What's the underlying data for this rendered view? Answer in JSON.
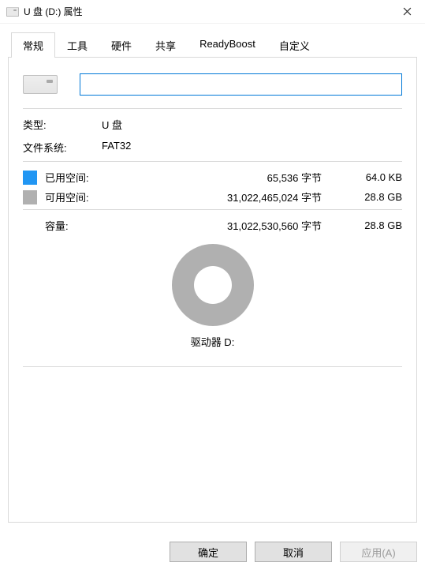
{
  "titlebar": {
    "title": "U 盘 (D:) 属性"
  },
  "tabs": [
    {
      "label": "常规",
      "active": true
    },
    {
      "label": "工具",
      "active": false
    },
    {
      "label": "硬件",
      "active": false
    },
    {
      "label": "共享",
      "active": false
    },
    {
      "label": "ReadyBoost",
      "active": false
    },
    {
      "label": "自定义",
      "active": false
    }
  ],
  "general": {
    "name_value": "",
    "type_label": "类型:",
    "type_value": "U 盘",
    "fs_label": "文件系统:",
    "fs_value": "FAT32",
    "used_label": "已用空间:",
    "used_bytes": "65,536 字节",
    "used_human": "64.0 KB",
    "used_color": "#2196f3",
    "free_label": "可用空间:",
    "free_bytes": "31,022,465,024 字节",
    "free_human": "28.8 GB",
    "free_color": "#b0b0b0",
    "capacity_label": "容量:",
    "capacity_bytes": "31,022,530,560 字节",
    "capacity_human": "28.8 GB",
    "drive_label": "驱动器 D:"
  },
  "buttons": {
    "ok": "确定",
    "cancel": "取消",
    "apply": "应用(A)"
  }
}
